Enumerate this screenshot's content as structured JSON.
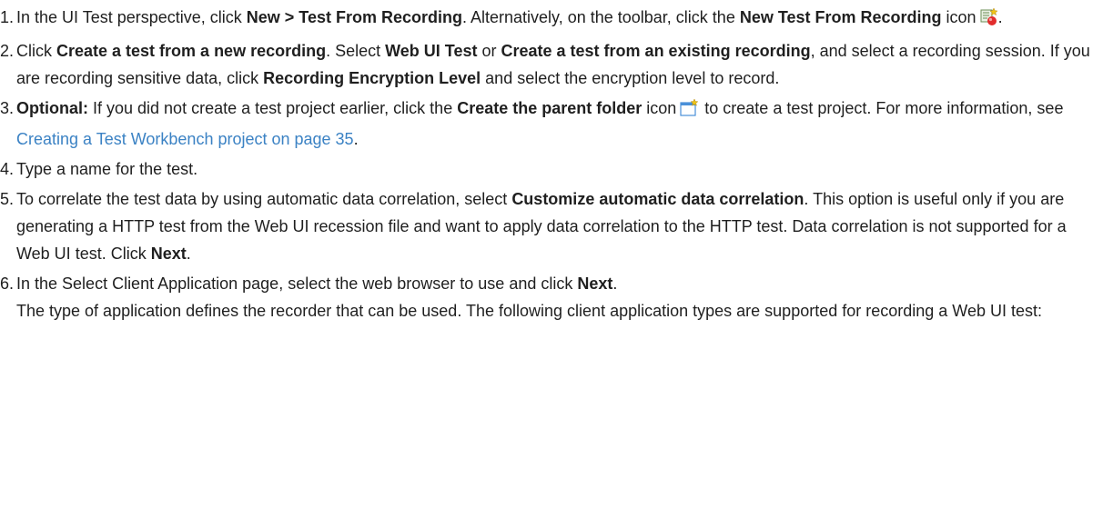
{
  "steps": [
    {
      "num": "1.",
      "t1": "In the UI Test perspective, click ",
      "b1": "New > Test From Recording",
      "t2": ". Alternatively, on the toolbar, click the ",
      "b2": "New Test From Recording",
      "t3": " icon",
      "t4": ".",
      "icon": "new-test-from-recording-icon"
    },
    {
      "num": "2.",
      "t1": "Click ",
      "b1": "Create a test from a new recording",
      "t2": ". Select ",
      "b2": "Web UI Test",
      "t3": " or ",
      "b3": "Create a test from an existing recording",
      "t4": ", and select a recording session. If you are recording sensitive data, click ",
      "b4": "Recording Encryption Level",
      "t5": " and select the encryption level to record."
    },
    {
      "num": "3.",
      "b1": "Optional:",
      "t1": "  If you did not create a test project earlier, click the ",
      "b2": "Create the parent folder",
      "t2": " icon",
      "t3": " to create a test project. For more information, see ",
      "link": "Creating a Test Workbench project on page 35",
      "t4": ".",
      "icon": "create-parent-folder-icon"
    },
    {
      "num": "4.",
      "t1": "Type a name for the test."
    },
    {
      "num": "5.",
      "t1": "To correlate the test data by using automatic data correlation, select ",
      "b1": "Customize automatic data correlation",
      "t2": ". This option is useful only if you are generating a HTTP test from the Web UI recession file and want to apply data correlation to the HTTP test. Data correlation is not supported for a Web UI test. Click ",
      "b2": "Next",
      "t3": "."
    },
    {
      "num": "6.",
      "t1": "In the Select Client Application page, select the web browser to use and click ",
      "b1": "Next",
      "t2": ".",
      "p2": "The type of application defines the recorder that can be used. The following client application types are supported for recording a Web UI test:"
    }
  ],
  "colors": {
    "link": "#3b82c4",
    "text": "#1f1f1f"
  }
}
